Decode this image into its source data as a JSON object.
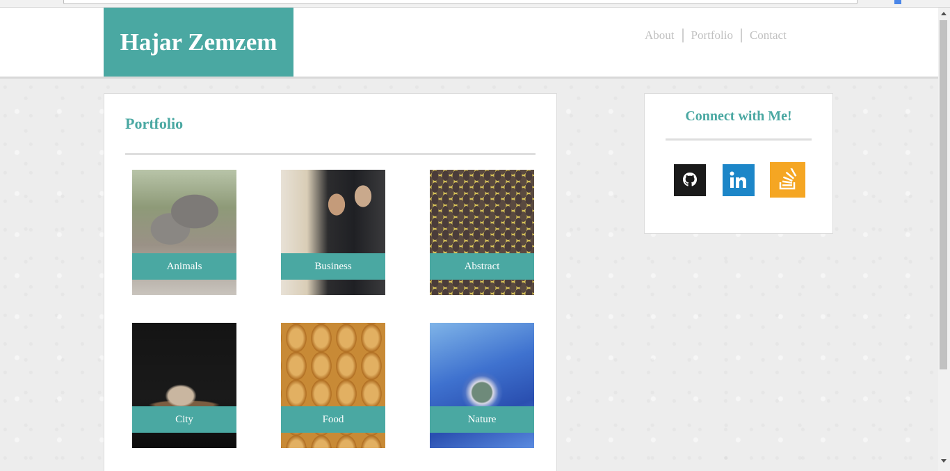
{
  "header": {
    "brand": "Hajar Zemzem",
    "nav": [
      {
        "label": "About"
      },
      {
        "label": "Portfolio"
      },
      {
        "label": "Contact"
      }
    ]
  },
  "portfolio": {
    "title": "Portfolio",
    "items": [
      {
        "label": "Animals"
      },
      {
        "label": "Business"
      },
      {
        "label": "Abstract"
      },
      {
        "label": "City"
      },
      {
        "label": "Food"
      },
      {
        "label": "Nature"
      }
    ]
  },
  "connect": {
    "title": "Connect with Me!",
    "links": [
      {
        "icon": "github-icon"
      },
      {
        "icon": "linkedin-icon"
      },
      {
        "icon": "stackoverflow-icon"
      }
    ]
  },
  "colors": {
    "accent": "#4aa8a2",
    "github": "#1a1a1a",
    "linkedin": "#1c86c8",
    "stackoverflow": "#f5a623"
  }
}
